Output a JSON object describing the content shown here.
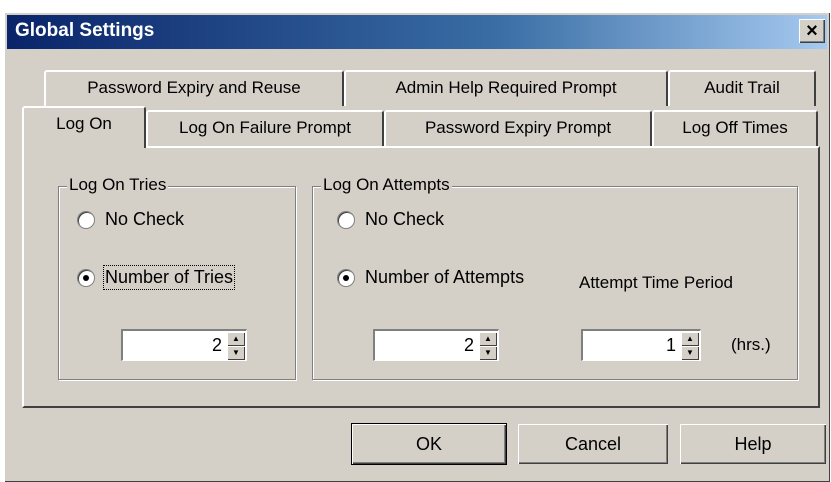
{
  "window": {
    "title": "Global Settings",
    "close_label": "×"
  },
  "tabs_row1": [
    {
      "label": "Password Expiry and Reuse"
    },
    {
      "label": "Admin Help Required Prompt"
    },
    {
      "label": "Audit Trail"
    }
  ],
  "tabs_row2": [
    {
      "label": "Log On",
      "active": true
    },
    {
      "label": "Log On Failure Prompt"
    },
    {
      "label": "Password Expiry Prompt"
    },
    {
      "label": "Log Off Times"
    }
  ],
  "log_on_tries": {
    "group_label": "Log On Tries",
    "no_check_label": "No Check",
    "number_label": "Number of Tries",
    "selected": "number",
    "value": "2"
  },
  "log_on_attempts": {
    "group_label": "Log On Attempts",
    "no_check_label": "No Check",
    "number_label": "Number of Attempts",
    "selected": "number",
    "value": "2",
    "period_label": "Attempt Time Period",
    "period_value": "1",
    "period_unit": "(hrs.)"
  },
  "buttons": {
    "ok": "OK",
    "cancel": "Cancel",
    "help": "Help"
  }
}
